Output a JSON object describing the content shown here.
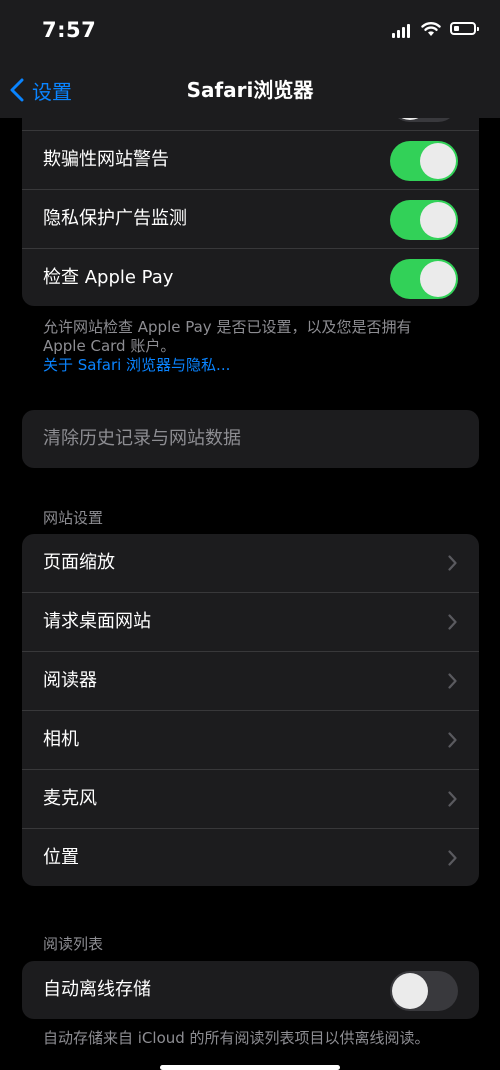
{
  "status": {
    "time": "7:57"
  },
  "nav": {
    "back_label": "设置",
    "title": "Safari浏览器"
  },
  "privacy_group": {
    "rows": [
      {
        "label": "欺骗性网站警告",
        "toggle": "on"
      },
      {
        "label": "隐私保护广告监测",
        "toggle": "on"
      },
      {
        "label": "检查 Apple Pay",
        "toggle": "on"
      }
    ]
  },
  "privacy_footnote": {
    "text": "允许网站检查 Apple Pay 是否已设置，以及您是否拥有 Apple Card 账户。",
    "link": "关于 Safari 浏览器与隐私..."
  },
  "clear_history": {
    "label": "清除历史记录与网站数据"
  },
  "website_settings": {
    "header": "网站设置",
    "rows": [
      {
        "label": "页面缩放"
      },
      {
        "label": "请求桌面网站"
      },
      {
        "label": "阅读器"
      },
      {
        "label": "相机"
      },
      {
        "label": "麦克风"
      },
      {
        "label": "位置"
      }
    ]
  },
  "reading_list": {
    "header": "阅读列表",
    "row": {
      "label": "自动离线存储",
      "toggle": "off"
    },
    "footnote": "自动存储来自 iCloud 的所有阅读列表项目以供离线阅读。"
  },
  "colors": {
    "accent": "#0a84ff",
    "toggle_on": "#32d158",
    "cell": "#1c1c1e",
    "secondary_text": "#8d8d92"
  }
}
